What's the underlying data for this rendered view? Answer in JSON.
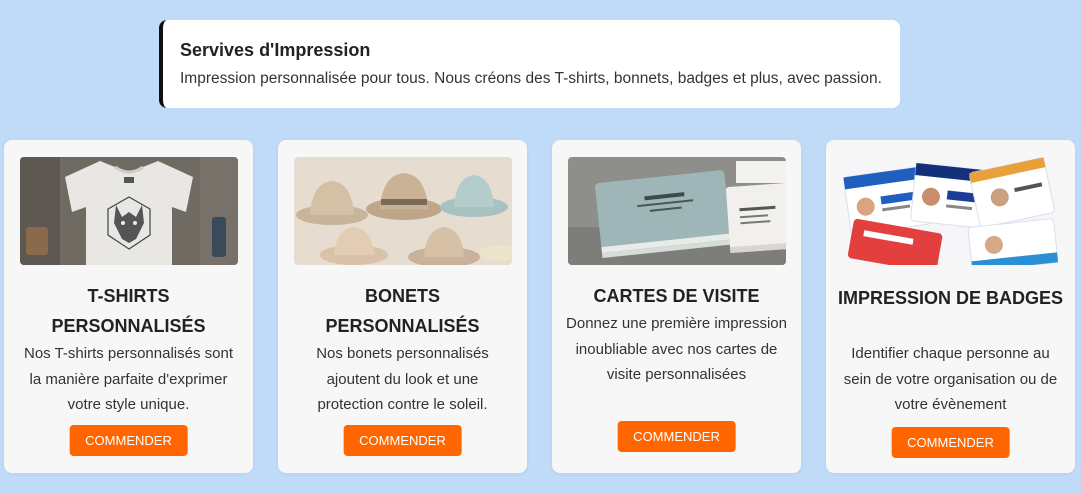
{
  "intro": {
    "title": "Servives d'Impression",
    "text": "Impression personnalisée pour tous. Nous créons des T-shirts, bonnets, badges et plus, avec passion."
  },
  "cards": [
    {
      "image": "tshirt-image",
      "title": "T-SHIRTS PERSONNALISÉS",
      "description": "Nos T-shirts personnalisés sont la manière parfaite d'exprimer votre style unique.",
      "button": "COMMENDER"
    },
    {
      "image": "hats-image",
      "title": "BONETS PERSONNALISÉS",
      "description": "Nos bonets personnalisés ajoutent du look et une protection contre le soleil.",
      "button": "COMMENDER"
    },
    {
      "image": "business-cards-image",
      "title": "CARTES DE VISITE",
      "description": "Donnez une première impression inoubliable avec nos cartes de visite personnalisées",
      "button": "COMMENDER"
    },
    {
      "image": "badges-image",
      "title": "IMPRESSION DE BADGES",
      "description": "Identifier chaque personne au sein de votre organisation ou de votre évènement",
      "button": "COMMENDER"
    }
  ],
  "colors": {
    "background": "#bfdbf7",
    "card": "#f7f7f7",
    "button": "#ff6600",
    "intro_border": "#111111"
  }
}
